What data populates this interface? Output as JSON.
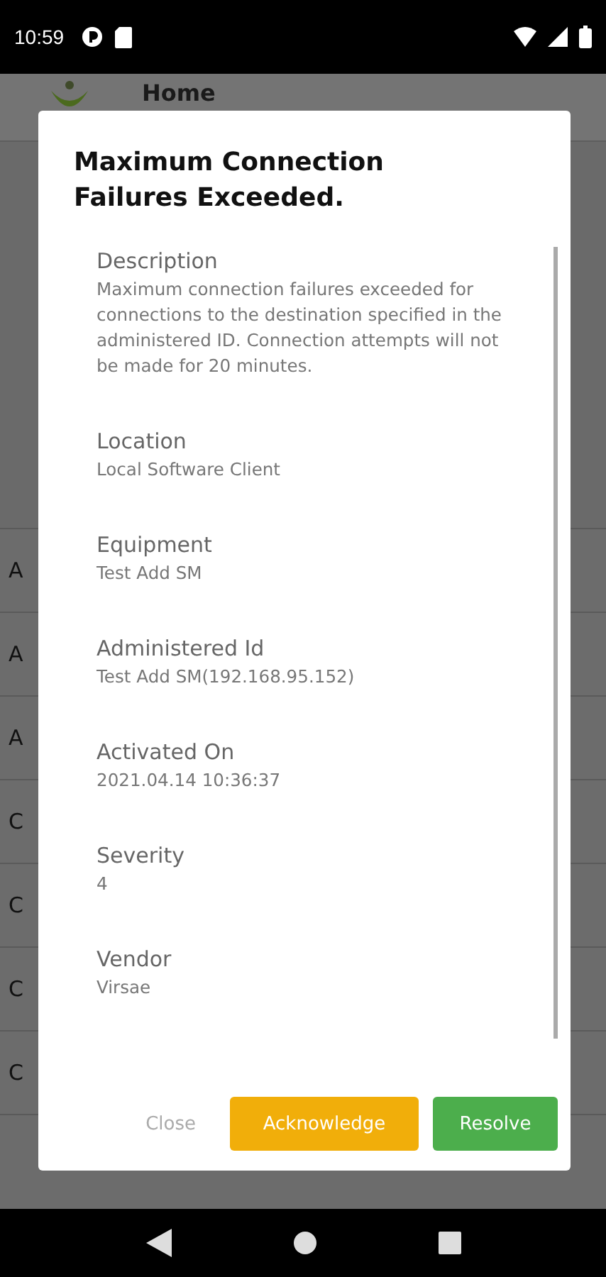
{
  "status_bar": {
    "time": "10:59"
  },
  "app_bar": {
    "title": "Home"
  },
  "background_rows": [
    "A",
    "A",
    "A",
    "C",
    "C",
    "C",
    "C"
  ],
  "dialog": {
    "title": "Maximum Connection Failures Exceeded.",
    "fields": [
      {
        "label": "Description",
        "value": "Maximum connection failures exceeded for connections to the destination specified in the administered ID. Connection attempts will not be made for 20 minutes."
      },
      {
        "label": "Location",
        "value": "Local Software Client"
      },
      {
        "label": "Equipment",
        "value": "Test Add SM"
      },
      {
        "label": "Administered Id",
        "value": "Test Add SM(192.168.95.152)"
      },
      {
        "label": "Activated On",
        "value": "2021.04.14 10:36:37"
      },
      {
        "label": "Severity",
        "value": "4"
      },
      {
        "label": "Vendor",
        "value": "Virsae"
      }
    ],
    "buttons": [
      {
        "label": "Close",
        "kind": "text"
      },
      {
        "label": "Acknowledge",
        "kind": "warning"
      },
      {
        "label": "Resolve",
        "kind": "success"
      }
    ]
  }
}
